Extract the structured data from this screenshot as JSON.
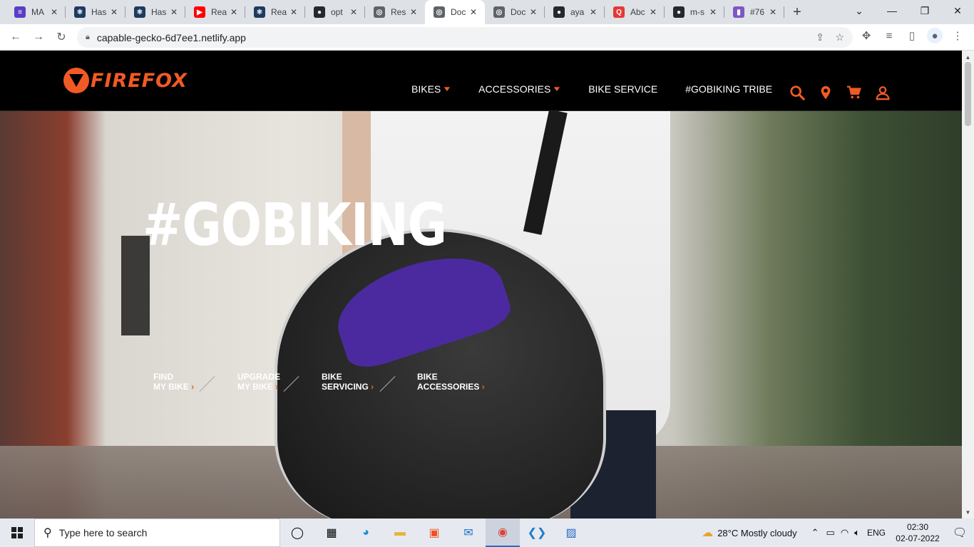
{
  "browser": {
    "tabs": [
      {
        "title": "MA",
        "fav_color": "#5b3cc4",
        "fav_glyph": "≡"
      },
      {
        "title": "Has",
        "fav_color": "#1e3a5f",
        "fav_glyph": "⚛"
      },
      {
        "title": "Has",
        "fav_color": "#1e3a5f",
        "fav_glyph": "⚛"
      },
      {
        "title": "Rea",
        "fav_color": "#ff0000",
        "fav_glyph": "▶"
      },
      {
        "title": "Rea",
        "fav_color": "#1e3a5f",
        "fav_glyph": "⚛"
      },
      {
        "title": "opt",
        "fav_color": "#24292f",
        "fav_glyph": "●"
      },
      {
        "title": "Res",
        "fav_color": "#5f6368",
        "fav_glyph": "◎"
      },
      {
        "title": "Doc",
        "fav_color": "#5f6368",
        "fav_glyph": "◎"
      },
      {
        "title": "Doc",
        "fav_color": "#5f6368",
        "fav_glyph": "◎"
      },
      {
        "title": "aya",
        "fav_color": "#24292f",
        "fav_glyph": "●"
      },
      {
        "title": "Abc",
        "fav_color": "#e53935",
        "fav_glyph": "Q"
      },
      {
        "title": "m-s",
        "fav_color": "#24292f",
        "fav_glyph": "●"
      },
      {
        "title": "#76",
        "fav_color": "#7e57c2",
        "fav_glyph": "▮"
      }
    ],
    "close_glyph": "✕",
    "newtab_glyph": "+",
    "url": "capable-gecko-6d7ee1.netlify.app"
  },
  "site": {
    "logo_text": "FIREFOX",
    "brand_color": "#f15a24",
    "nav": [
      {
        "label": "BIKES",
        "has_dropdown": true
      },
      {
        "label": "ACCESSORIES",
        "has_dropdown": true
      },
      {
        "label": "BIKE SERVICE",
        "has_dropdown": false
      },
      {
        "label": "#GOBIKING TRIBE",
        "has_dropdown": false
      }
    ],
    "icons": [
      "search-icon",
      "location-icon",
      "cart-icon",
      "user-icon"
    ]
  },
  "hero": {
    "title": "#GOBIKING",
    "links": [
      {
        "line1": "FIND",
        "line2": "MY BIKE"
      },
      {
        "line1": "UPGRADE",
        "line2": "MY BIKE"
      },
      {
        "line1": "BIKE",
        "line2": "SERVICING"
      },
      {
        "line1": "BIKE",
        "line2": "ACCESSORIES"
      }
    ]
  },
  "taskbar": {
    "search_placeholder": "Type here to search",
    "weather": "28°C  Mostly cloudy",
    "language": "ENG",
    "time": "02:30",
    "date": "02-07-2022"
  }
}
